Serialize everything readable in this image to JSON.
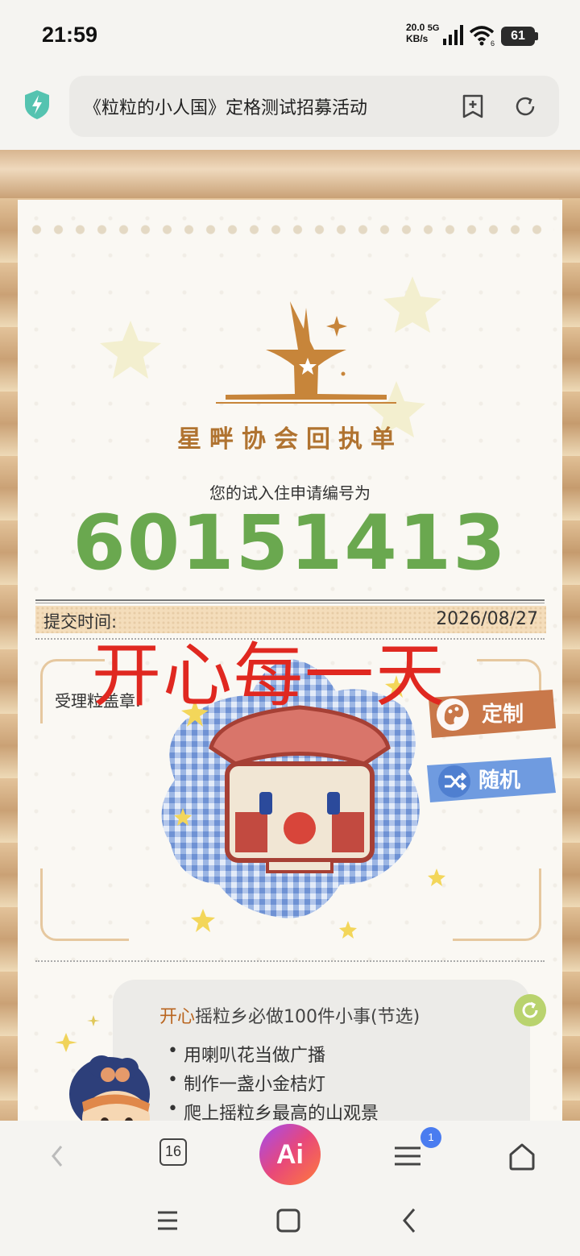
{
  "status_bar": {
    "time": "21:59",
    "net_speed_value": "20.0",
    "net_speed_unit": "KB/s",
    "network_type": "5G",
    "wifi_level": "6",
    "battery": "61"
  },
  "address_bar": {
    "page_title": "《粒粒的小人国》定格测试招募活动"
  },
  "receipt": {
    "logo_title": "星畔协会回执单",
    "subtitle": "您的试入住申请编号为",
    "application_number": "60151413",
    "submit_label": "提交时间:",
    "submit_date": "2026/08/27",
    "stamp_label": "受理粒盖章:",
    "overlay_text": "开心每一天",
    "buttons": {
      "custom": "定制",
      "random": "随机"
    }
  },
  "info_card": {
    "title_accent": "开心",
    "title_rest": "摇粒乡必做100件小事(节选)",
    "items": [
      "用喇叭花当做广播",
      "制作一盏小金桔灯",
      "爬上摇粒乡最高的山观景"
    ]
  },
  "toolbar": {
    "tabs_count": "16",
    "ai_label": "Ai",
    "menu_badge": "1"
  },
  "colors": {
    "number_green": "#6aa84f",
    "overlay_red": "#e02820",
    "custom_button": "#c9784a",
    "random_button": "#6f9be0"
  }
}
